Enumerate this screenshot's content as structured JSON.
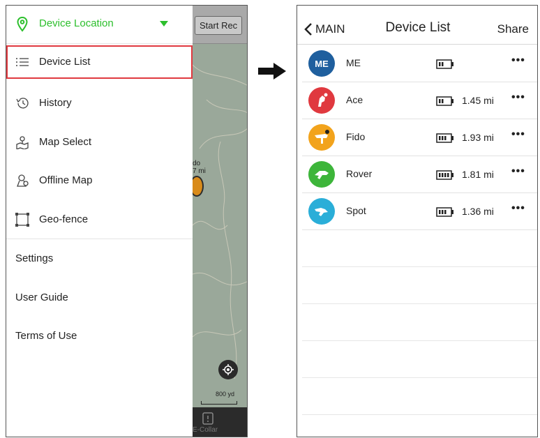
{
  "left_phone": {
    "map": {
      "start_rec_label": "Start Rec",
      "pin_label_line1": "do",
      "pin_label_line2": "7 mi",
      "scale_label": "800 yd",
      "bottom_tab_label": "E-Collar"
    },
    "drawer": {
      "header_title": "Device Location",
      "accent_color": "#2cbf2c",
      "menu_items": [
        {
          "label": "Device List",
          "icon": "list-icon",
          "selected": true
        },
        {
          "label": "History",
          "icon": "history-icon"
        },
        {
          "label": "Map Select",
          "icon": "map-select-icon"
        },
        {
          "label": "Offline Map",
          "icon": "offline-map-icon"
        },
        {
          "label": "Geo-fence",
          "icon": "geo-fence-icon"
        }
      ],
      "plain_items": [
        {
          "label": "Settings"
        },
        {
          "label": "User Guide"
        },
        {
          "label": "Terms of Use"
        }
      ],
      "selection_color": "#e0393f"
    }
  },
  "right_phone": {
    "back_label": "MAIN",
    "title": "Device List",
    "share_label": "Share",
    "devices": [
      {
        "name": "ME",
        "avatar_text": "ME",
        "avatar_color": "#1f5f9e",
        "battery_bars": 2,
        "distance": ""
      },
      {
        "name": "Ace",
        "avatar_text": "",
        "avatar_color": "#e0393f",
        "battery_bars": 2,
        "distance": "1.45 mi"
      },
      {
        "name": "Fido",
        "avatar_text": "",
        "avatar_color": "#f2a31c",
        "battery_bars": 3,
        "distance": "1.93 mi"
      },
      {
        "name": "Rover",
        "avatar_text": "",
        "avatar_color": "#3db53a",
        "battery_bars": 4,
        "distance": "1.81 mi"
      },
      {
        "name": "Spot",
        "avatar_text": "",
        "avatar_color": "#2aaed8",
        "battery_bars": 3,
        "distance": "1.36 mi"
      }
    ],
    "more_label": "•••"
  }
}
